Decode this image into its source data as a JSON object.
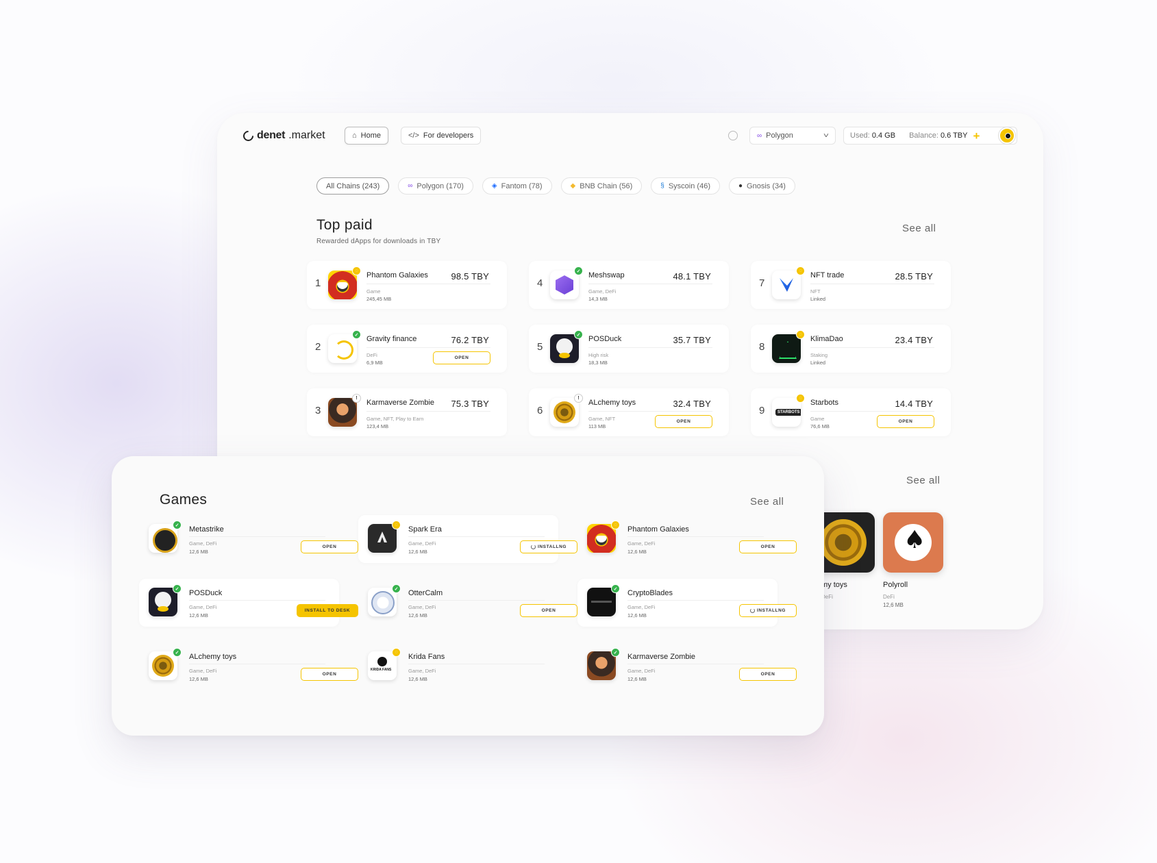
{
  "header": {
    "logo_bold": "denet",
    "logo_rest": ".market",
    "nav_home": "Home",
    "nav_dev": "For developers",
    "network": "Polygon",
    "used_label": "Used:",
    "used_value": "0.4 GB",
    "balance_label": "Balance:",
    "balance_value": "0.6 TBY",
    "plus": "+"
  },
  "chains": [
    {
      "label": "All Chains (243)",
      "icon": ""
    },
    {
      "label": "Polygon (170)",
      "icon": "polygon-icon"
    },
    {
      "label": "Fantom (78)",
      "icon": "fantom-icon"
    },
    {
      "label": "BNB Chain (56)",
      "icon": "bnb-icon"
    },
    {
      "label": "Syscoin (46)",
      "icon": "syscoin-icon"
    },
    {
      "label": "Gnosis (34)",
      "icon": "gnosis-icon"
    }
  ],
  "top_paid": {
    "title": "Top paid",
    "subtitle": "Rewarded dApps for downloads in TBY",
    "see_all": "See all",
    "items": [
      {
        "rank": "1",
        "name": "Phantom Galaxies",
        "price": "98.5 TBY",
        "tags": "Game",
        "size": "245,45 MB",
        "button": "",
        "badge": "yellow",
        "art": "red"
      },
      {
        "rank": "2",
        "name": "Gravity finance",
        "price": "76.2 TBY",
        "tags": "DeFi",
        "size": "6,9 MB",
        "button": "OPEN",
        "badge": "green",
        "art": "gravity"
      },
      {
        "rank": "3",
        "name": "Karmaverse Zombie",
        "price": "75.3 TBY",
        "tags": "Game, NFT, Play to Earn",
        "size": "123,4 MB",
        "button": "",
        "badge": "warn",
        "art": "zombie"
      },
      {
        "rank": "4",
        "name": "Meshswap",
        "price": "48.1 TBY",
        "tags": "Game, DeFi",
        "size": "14,3 MB",
        "button": "",
        "badge": "green",
        "art": "meshswap"
      },
      {
        "rank": "5",
        "name": "POSDuck",
        "price": "35.7 TBY",
        "tags": "High risk",
        "size": "18,3 MB",
        "button": "",
        "badge": "green",
        "art": "duck"
      },
      {
        "rank": "6",
        "name": "ALchemy toys",
        "price": "32.4 TBY",
        "tags": "Game, NFT",
        "size": "113 MB",
        "button": "OPEN",
        "badge": "warn",
        "art": "coin"
      },
      {
        "rank": "7",
        "name": "NFT trade",
        "price": "28.5 TBY",
        "tags": "NFT",
        "size": "Linked",
        "button": "",
        "badge": "yellow",
        "art": "nft"
      },
      {
        "rank": "8",
        "name": "KlimaDao",
        "price": "23.4 TBY",
        "tags": "Staking",
        "size": "Linked",
        "button": "",
        "badge": "yellow",
        "art": "klima"
      },
      {
        "rank": "9",
        "name": "Starbots",
        "price": "14.4 TBY",
        "tags": "Game",
        "size": "76,6 MB",
        "button": "OPEN",
        "badge": "yellow",
        "art": "starbots"
      }
    ]
  },
  "second_section": {
    "see_all": "See all",
    "items": [
      {
        "name": "my toys",
        "tags": "DeFi",
        "size": ""
      },
      {
        "name": "Polyroll",
        "tags": "DeFi",
        "size": "12,6 MB"
      }
    ]
  },
  "games": {
    "title": "Games",
    "see_all": "See all",
    "items": [
      {
        "name": "Metastrike",
        "tags": "Game, DeFi",
        "size": "12,6 MB",
        "button": "OPEN",
        "badge": "green",
        "art": "meta"
      },
      {
        "name": "POSDuck",
        "tags": "Game, DeFi",
        "size": "12,6 MB",
        "button": "INSTALL TO DESK",
        "badge": "green",
        "art": "duck"
      },
      {
        "name": "ALchemy toys",
        "tags": "Game, DeFi",
        "size": "12,6 MB",
        "button": "OPEN",
        "badge": "green",
        "art": "coin"
      },
      {
        "name": "Spark Era",
        "tags": "Game, DeFi",
        "size": "12,6 MB",
        "button": "INSTALLNG",
        "badge": "yellow",
        "art": "spark"
      },
      {
        "name": "OtterCalm",
        "tags": "Game, DeFi",
        "size": "12,6 MB",
        "button": "OPEN",
        "badge": "green",
        "art": "otter"
      },
      {
        "name": "Krida Fans",
        "tags": "Game, DeFi",
        "size": "12,6 MB",
        "button": "",
        "badge": "yellow",
        "art": "krida"
      },
      {
        "name": "Phantom Galaxies",
        "tags": "Game, DeFi",
        "size": "12,6 MB",
        "button": "OPEN",
        "badge": "yellow",
        "art": "red"
      },
      {
        "name": "CryptoBlades",
        "tags": "Game, DeFi",
        "size": "12,6 MB",
        "button": "INSTALLNG",
        "badge": "green",
        "art": "crypto"
      },
      {
        "name": "Karmaverse Zombie",
        "tags": "Game, DeFi",
        "size": "12,6 MB",
        "button": "OPEN",
        "badge": "green",
        "art": "zombie"
      }
    ]
  },
  "colors": {
    "accent": "#f5c400",
    "verified": "#37b24d",
    "text": "#1c1c1c"
  }
}
